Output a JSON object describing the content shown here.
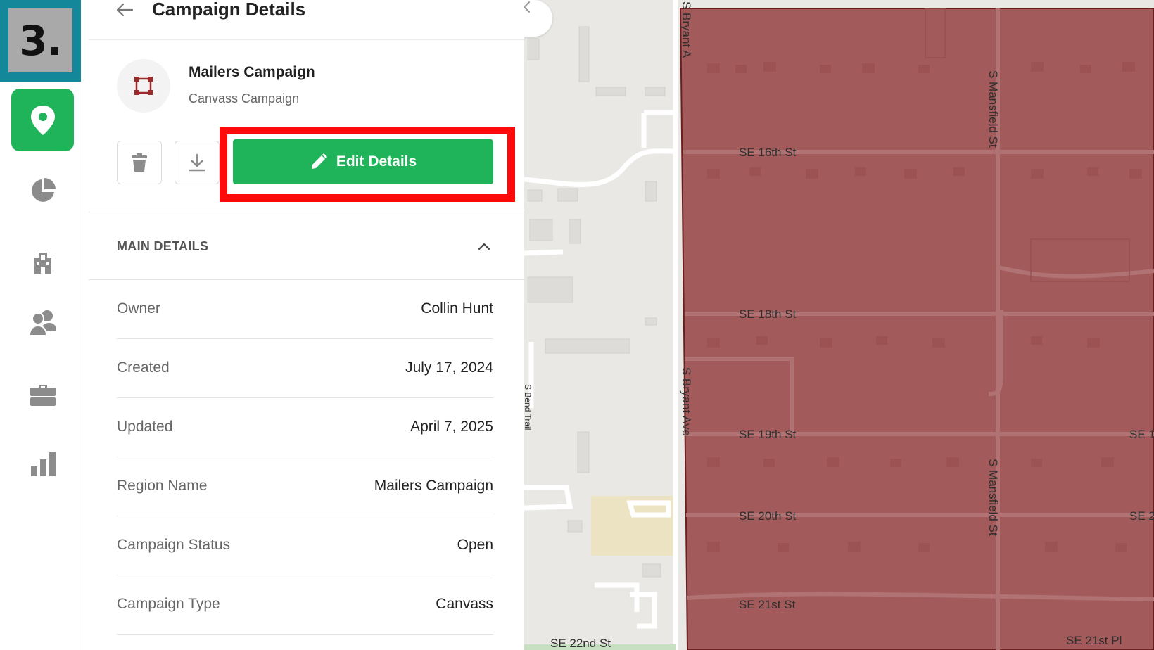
{
  "step_badge": {
    "label": "3."
  },
  "sidebar": {
    "items": [
      {
        "name": "map-pin",
        "active": true
      },
      {
        "name": "pie-chart",
        "active": false
      },
      {
        "name": "building",
        "active": false
      },
      {
        "name": "users",
        "active": false
      },
      {
        "name": "briefcase",
        "active": false
      },
      {
        "name": "bar-chart",
        "active": false
      }
    ]
  },
  "panel": {
    "title": "Campaign Details",
    "campaign": {
      "name": "Mailers Campaign",
      "subtitle": "Canvass Campaign"
    },
    "actions": {
      "edit_label": "Edit Details"
    },
    "section": {
      "title": "MAIN DETAILS"
    },
    "details": [
      {
        "label": "Owner",
        "value": "Collin Hunt"
      },
      {
        "label": "Created",
        "value": "July 17, 2024"
      },
      {
        "label": "Updated",
        "value": "April 7, 2025"
      },
      {
        "label": "Region Name",
        "value": "Mailers Campaign"
      },
      {
        "label": "Campaign Status",
        "value": "Open"
      },
      {
        "label": "Campaign Type",
        "value": "Canvass"
      }
    ]
  },
  "map": {
    "streets": {
      "se16": "SE 16th St",
      "se18": "SE 18th St",
      "se19": "SE 19th St",
      "se20": "SE 20th St",
      "se21": "SE 21st St",
      "se22": "SE 22nd St",
      "se21pl": "SE 21st Pl",
      "se19_cut": "SE 1",
      "se20_cut": "SE 2",
      "bryant": "S Bryant Ave",
      "bryant_top": "S Bryant A",
      "mansfield_top": "S Mansfield St",
      "mansfield_bottom": "S Mansfield St",
      "trail": "S Bend Trail"
    }
  },
  "colors": {
    "brand_green": "#1fb35a",
    "highlight_red": "#ff0a0a",
    "badge_teal": "#15879a",
    "region_fill": "#a25a5a"
  }
}
